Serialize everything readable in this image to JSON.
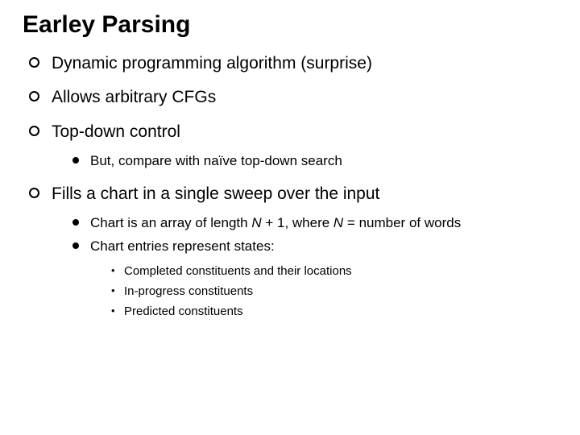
{
  "title": "Earley Parsing",
  "b1": "Dynamic programming algorithm (surprise)",
  "b2": "Allows arbitrary CFGs",
  "b3": "Top-down control",
  "b3s1": "But, compare with naïve top-down search",
  "b4": "Fills a chart in a single sweep over the input",
  "b4s1_a": "Chart is an array of length ",
  "b4s1_N1": "N",
  "b4s1_b": " + 1, where ",
  "b4s1_N2": "N",
  "b4s1_c": " = number of words",
  "b4s2": "Chart entries represent states:",
  "b4s2i1": "Completed constituents and their locations",
  "b4s2i2": "In-progress constituents",
  "b4s2i3": "Predicted constituents"
}
